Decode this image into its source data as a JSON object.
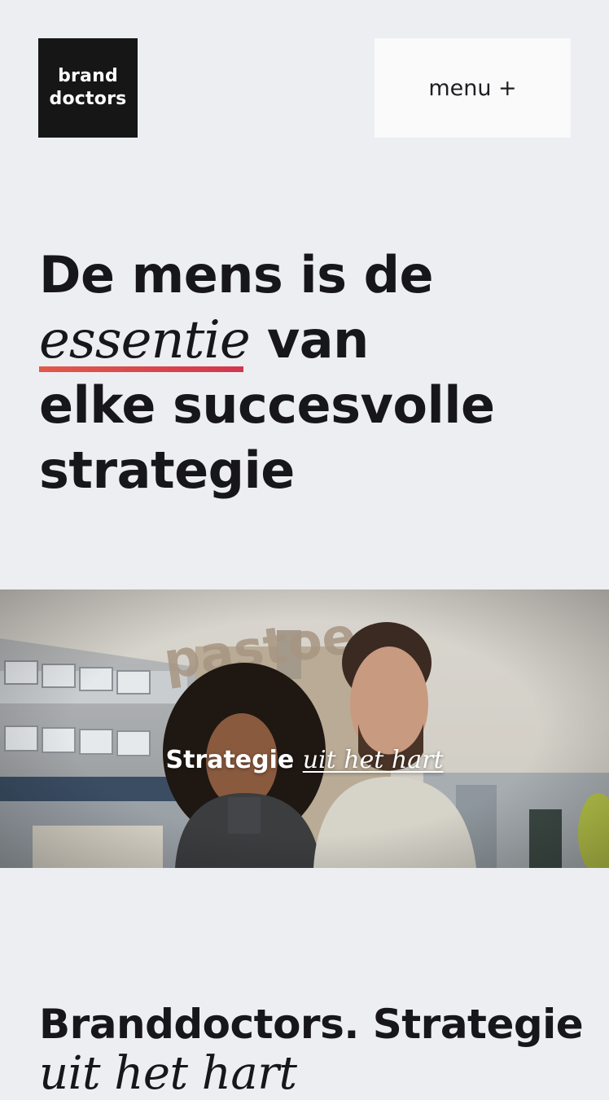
{
  "header": {
    "logo_line1": "brand",
    "logo_line2": "doctors",
    "menu_label": "menu +"
  },
  "hero": {
    "line1": "De mens is de",
    "line2_italic": "essentie",
    "line2_rest": "van",
    "line3": "elke succesvolle",
    "line4": "strategie",
    "accent_gradient": [
      "#e15a4a",
      "#d2364e"
    ]
  },
  "banner": {
    "building_sign": "pastoe",
    "caption_bold": "Strategie",
    "caption_italic": "uit het hart"
  },
  "section": {
    "heading_bold": "Branddoctors. Strategie",
    "heading_italic": "uit het hart"
  },
  "colors": {
    "background": "#edeef2",
    "logo_bg": "#161616",
    "menu_bg": "#fafafb",
    "text": "#17171b"
  }
}
